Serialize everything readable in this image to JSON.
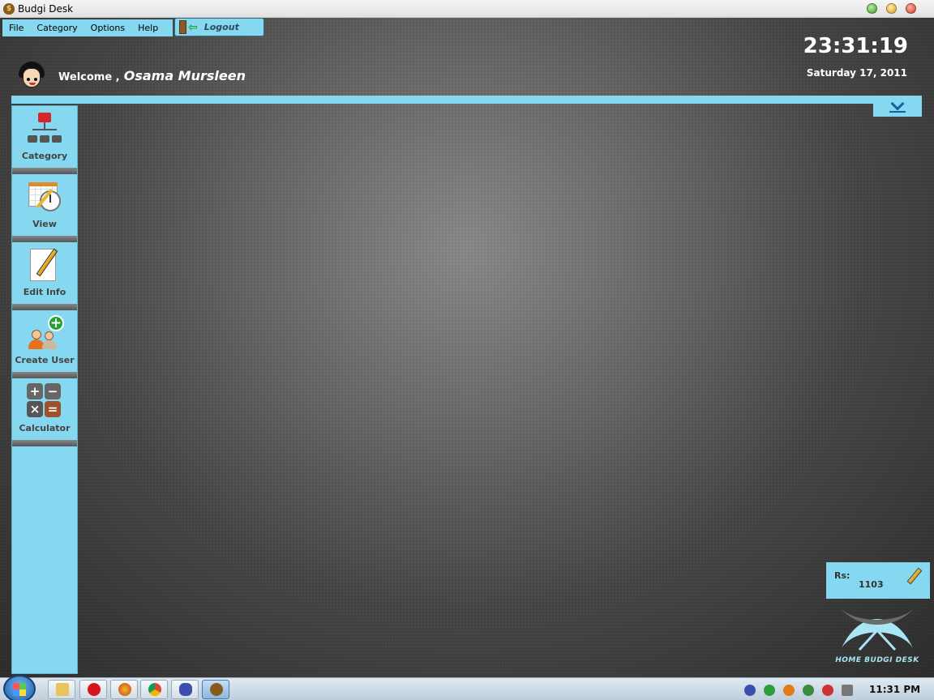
{
  "window": {
    "title": "Budgi Desk"
  },
  "menu": {
    "items": [
      {
        "label": "File"
      },
      {
        "label": "Category"
      },
      {
        "label": "Options"
      },
      {
        "label": "Help"
      }
    ],
    "logout_label": "Logout"
  },
  "header": {
    "welcome_label": "Welcome ,",
    "user_name": "Osama Mursleen",
    "time": "23:31:19",
    "date": "Saturday 17, 2011"
  },
  "sidebar": {
    "items": [
      {
        "label": "Category",
        "icon": "category-tree-icon"
      },
      {
        "label": "View",
        "icon": "calendar-clock-icon"
      },
      {
        "label": "Edit Info",
        "icon": "edit-pencil-icon"
      },
      {
        "label": "Create User",
        "icon": "add-user-icon"
      },
      {
        "label": "Calculator",
        "icon": "calculator-icon"
      }
    ]
  },
  "calculator_keys": [
    "+",
    "−",
    "×",
    "="
  ],
  "balance": {
    "currency_label": "Rs:",
    "amount": "1103"
  },
  "logo": {
    "text": "HOME BUDGI DESK"
  },
  "taskbar": {
    "clock": "11:31 PM"
  },
  "colors": {
    "accent": "#86d8f0",
    "background": "#3a3a3a"
  }
}
